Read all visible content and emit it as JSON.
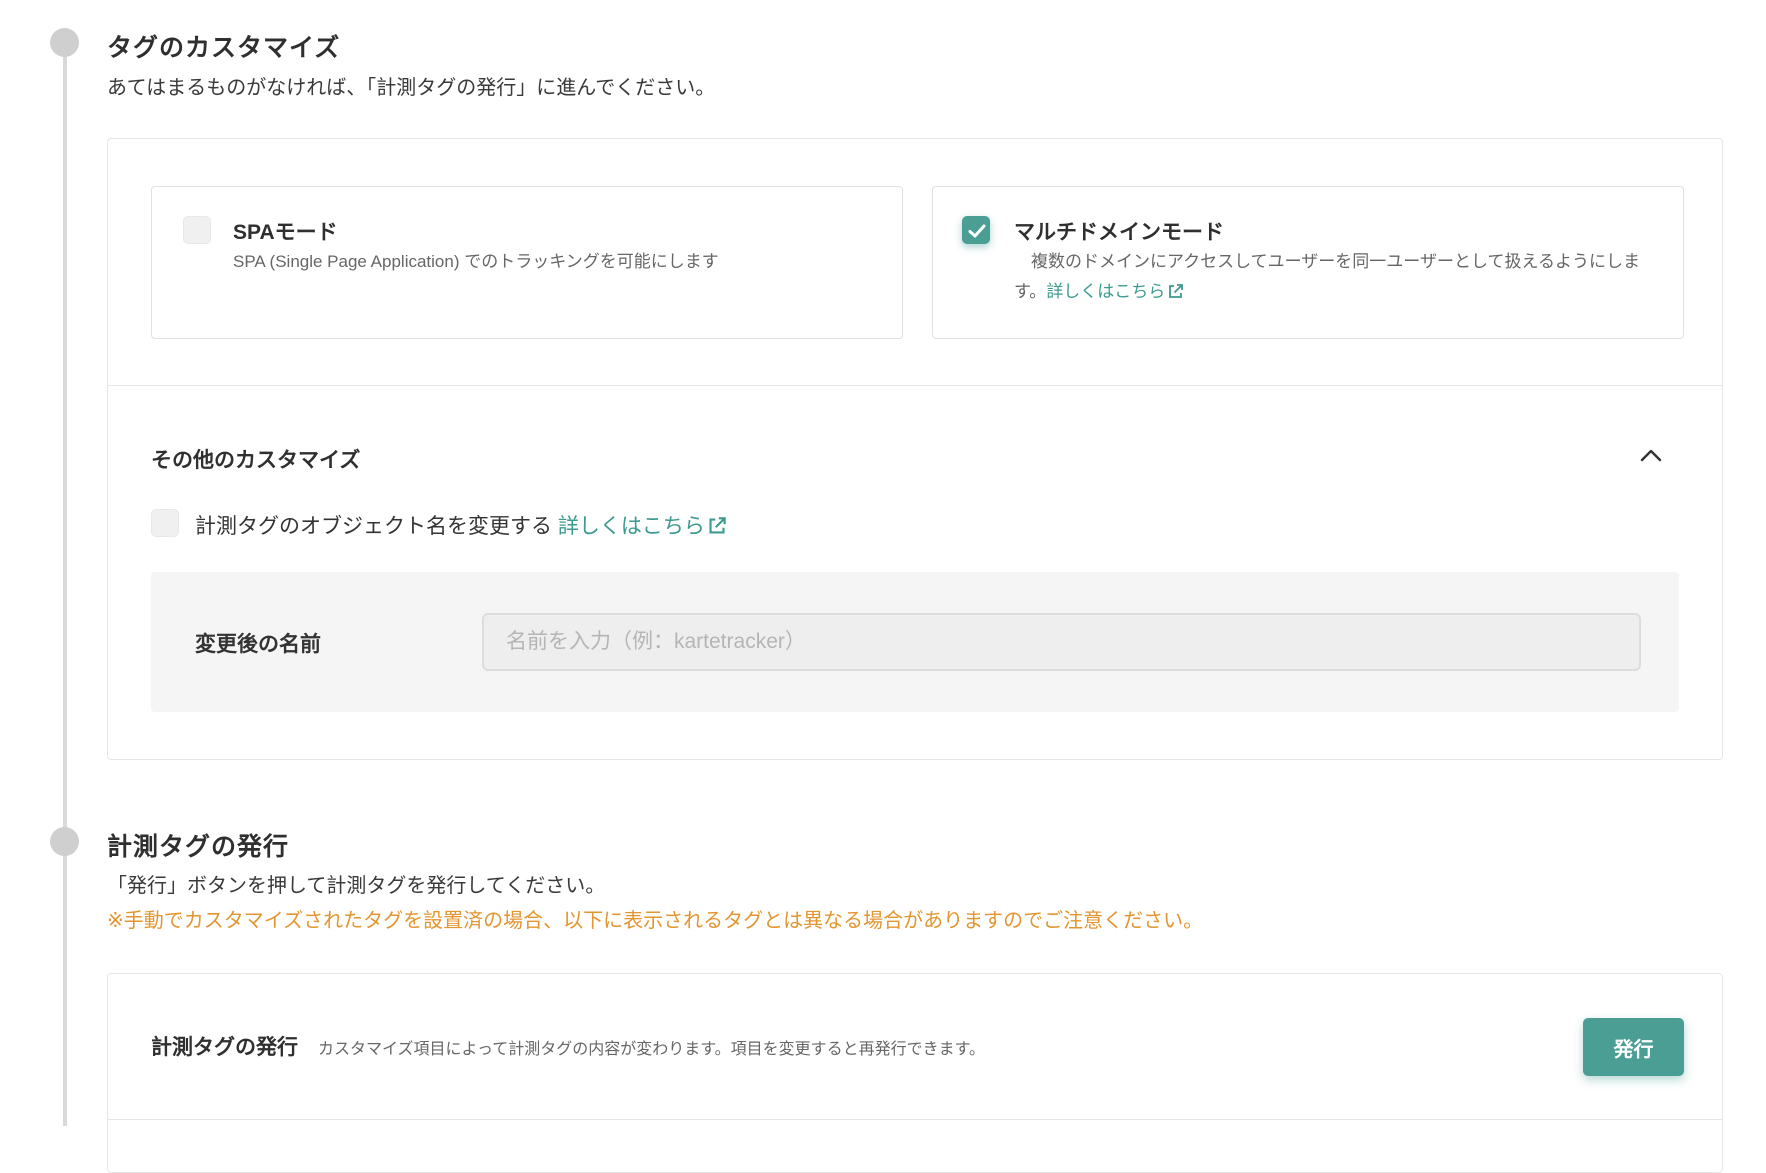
{
  "steps": [
    {
      "title": "タグのカスタマイズ",
      "description": "あてはまるものがなければ、「計測タグの発行」に進んでください。",
      "modes": [
        {
          "title": "SPAモード",
          "description": "SPA (Single Page Application) でのトラッキングを可能にします",
          "checked": false
        },
        {
          "title": "マルチドメインモード",
          "description": "複数のドメインにアクセスしてユーザーを同一ユーザーとして扱えるようにします。",
          "link": "詳しくはこちら",
          "checked": true
        }
      ],
      "other": {
        "heading": "その他のカスタマイズ",
        "expanded": true,
        "option_label": "計測タグのオブジェクト名を変更する",
        "option_link": "詳しくはこちら",
        "option_checked": false,
        "field_label": "変更後の名前",
        "field_placeholder": "名前を入力（例：kartetracker）",
        "field_value": ""
      }
    },
    {
      "title": "計測タグの発行",
      "description": "「発行」ボタンを押して計測タグを発行してください。",
      "warning": "※手動でカスタマイズされたタグを設置済の場合、以下に表示されるタグとは異なる場合がありますのでご注意ください。",
      "panel_title": "計測タグの発行",
      "panel_description": "カスタマイズ項目によって計測タグの内容が変わります。項目を変更すると再発行できます。",
      "button_label": "発行"
    }
  ],
  "colors": {
    "accent": "#4a9e94",
    "link": "#3c9a8f",
    "warning": "#e3962f",
    "timeline": "#d9d9d9"
  },
  "icons": {
    "checkmark": "check-icon",
    "external_link": "external-link-icon",
    "collapse": "chevron-up-icon"
  }
}
